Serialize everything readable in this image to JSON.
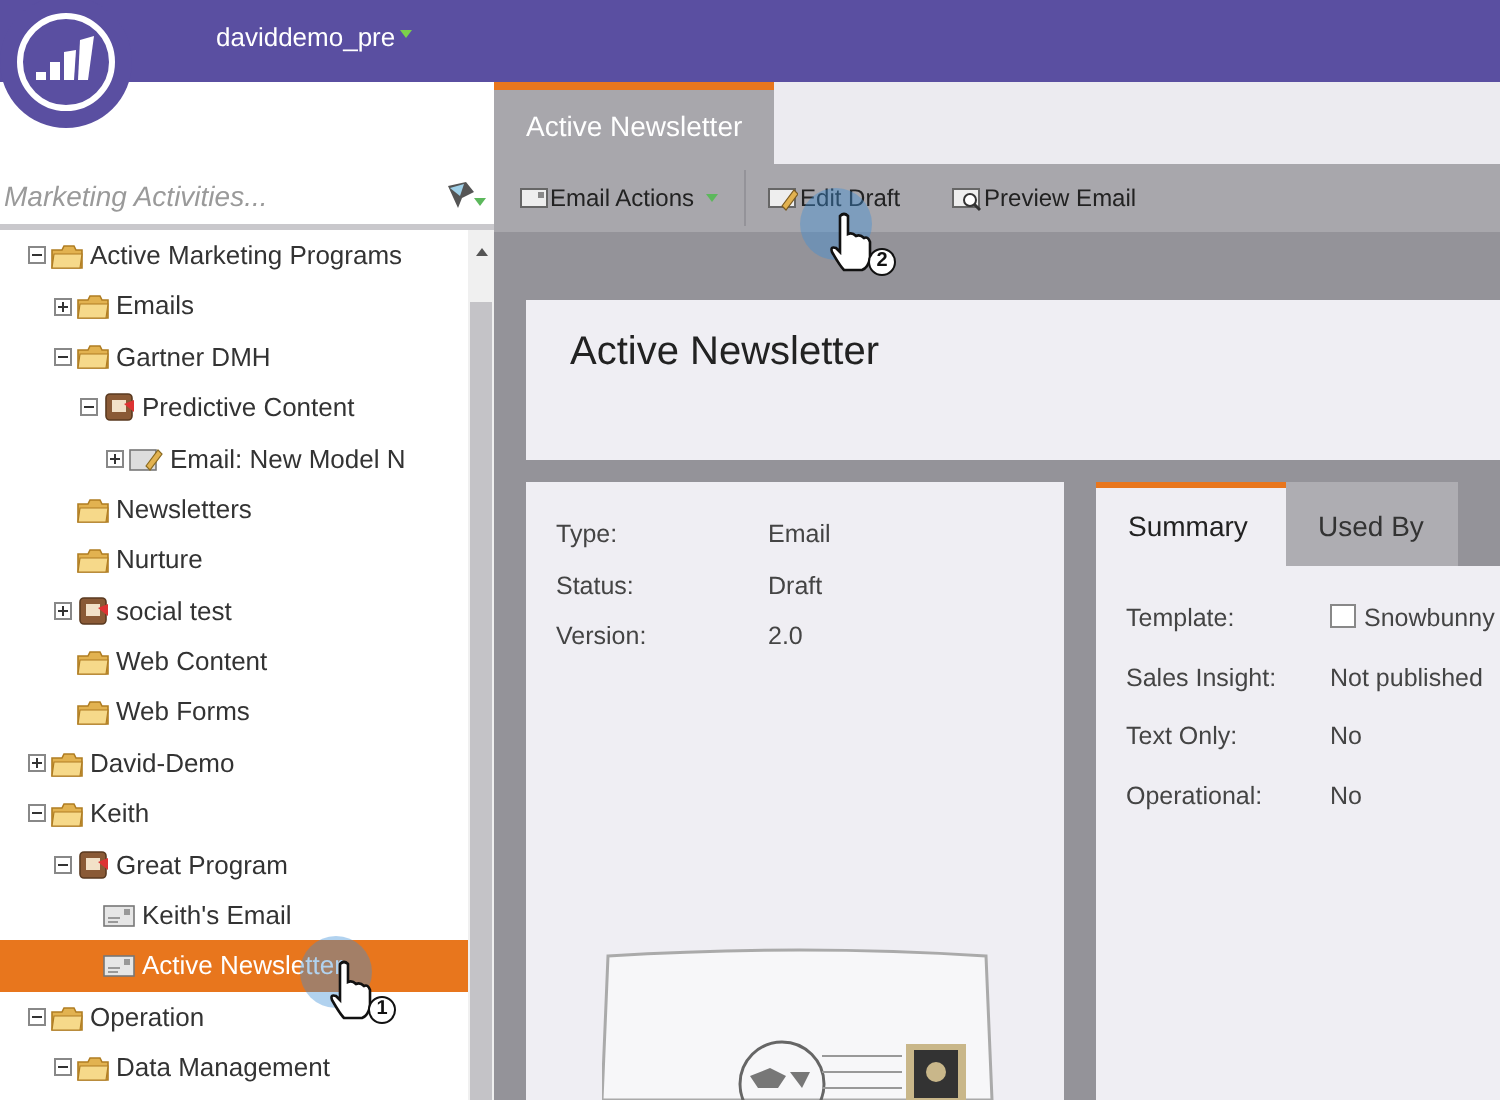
{
  "header": {
    "workspace": "daviddemo_pre"
  },
  "sidebar": {
    "search": {
      "placeholder": "Marketing Activities..."
    },
    "tree": [
      {
        "label": "Active Marketing Programs",
        "kind": "folder",
        "expanded": true,
        "selected": false,
        "children": [
          {
            "label": "Emails",
            "kind": "folder",
            "expanded": false,
            "selected": false
          },
          {
            "label": "Gartner DMH",
            "kind": "folder",
            "expanded": true,
            "selected": false,
            "children": [
              {
                "label": "Predictive Content",
                "kind": "program",
                "expanded": true,
                "selected": false,
                "children": [
                  {
                    "label": "Email: New Model N",
                    "kind": "email-program",
                    "expanded": false,
                    "selected": false
                  }
                ]
              }
            ]
          },
          {
            "label": "Newsletters",
            "kind": "folder",
            "selected": false
          },
          {
            "label": "Nurture",
            "kind": "folder",
            "selected": false
          },
          {
            "label": "social test",
            "kind": "program",
            "expanded": false,
            "selected": false
          },
          {
            "label": "Web Content",
            "kind": "folder",
            "selected": false
          },
          {
            "label": "Web Forms",
            "kind": "folder",
            "selected": false
          }
        ]
      },
      {
        "label": "David-Demo",
        "kind": "folder",
        "expanded": false,
        "selected": false
      },
      {
        "label": "Keith",
        "kind": "folder",
        "expanded": true,
        "selected": false,
        "children": [
          {
            "label": "Great Program",
            "kind": "program",
            "expanded": true,
            "selected": false,
            "children": [
              {
                "label": "Keith's Email",
                "kind": "email",
                "selected": false
              },
              {
                "label": "Active Newsletter",
                "kind": "email",
                "selected": true
              }
            ]
          }
        ]
      },
      {
        "label": "Operation",
        "kind": "folder",
        "expanded": true,
        "selected": false,
        "children": [
          {
            "label": "Data Management",
            "kind": "folder",
            "expanded": true,
            "selected": false
          }
        ]
      }
    ]
  },
  "tabs": [
    {
      "label": "Active Newsletter",
      "selected": true
    }
  ],
  "toolbar": [
    {
      "label": "Email Actions",
      "kind": "menu"
    },
    {
      "label": "Edit Draft",
      "kind": "edit"
    },
    {
      "label": "Preview Email",
      "kind": "preview"
    }
  ],
  "title": "Active Newsletter",
  "details": [
    {
      "label": "Type:",
      "value": "Email"
    },
    {
      "label": "Status:",
      "value": "Draft"
    },
    {
      "label": "Version:",
      "value": "2.0"
    }
  ],
  "detail_tabs": [
    {
      "label": "Summary",
      "selected": true
    },
    {
      "label": "Used By",
      "selected": false
    }
  ],
  "summary": [
    {
      "label": "Template:",
      "value": "Snowbunny",
      "kind": "template"
    },
    {
      "label": "Sales Insight:",
      "value": "Not published"
    },
    {
      "label": "Text Only:",
      "value": "No"
    },
    {
      "label": "Operational:",
      "value": "No"
    }
  ],
  "callouts": [
    {
      "number": "1"
    },
    {
      "number": "2"
    }
  ]
}
